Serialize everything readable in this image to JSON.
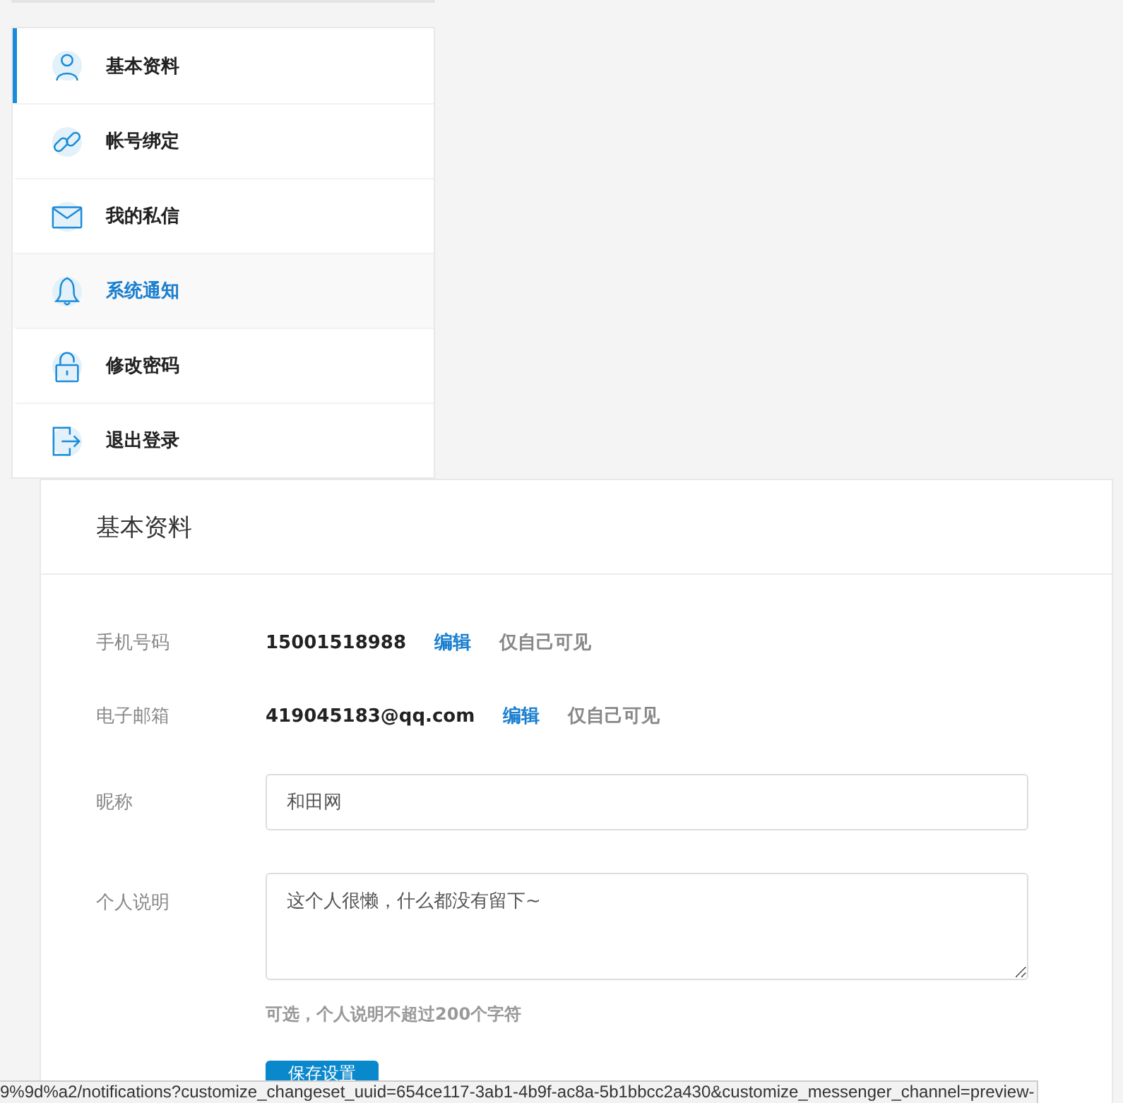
{
  "sidebar": {
    "items": [
      {
        "label": "基本资料",
        "kind": "user",
        "selected": true,
        "highlighted": false
      },
      {
        "label": "帐号绑定",
        "kind": "link",
        "selected": false,
        "highlighted": false
      },
      {
        "label": "我的私信",
        "kind": "mail",
        "selected": false,
        "highlighted": false
      },
      {
        "label": "系统通知",
        "kind": "bell",
        "selected": false,
        "highlighted": true
      },
      {
        "label": "修改密码",
        "kind": "lock",
        "selected": false,
        "highlighted": false
      },
      {
        "label": "退出登录",
        "kind": "logout",
        "selected": false,
        "highlighted": false
      }
    ]
  },
  "profile": {
    "title": "基本资料",
    "info_rows": [
      {
        "label": "手机号码",
        "value": "15001518988",
        "action": "编辑",
        "visibility": "仅自己可见"
      },
      {
        "label": "电子邮箱",
        "value": "419045183@qq.com",
        "action": "编辑",
        "visibility": "仅自己可见"
      }
    ],
    "nickname": {
      "label": "昵称",
      "value": "和田网"
    },
    "bio": {
      "label": "个人说明",
      "value": "这个人很懒，什么都没有留下~",
      "hint": "可选，个人说明不超过200个字符"
    },
    "save_button": "保存设置"
  },
  "status_bar": "9%9d%a2/notifications?customize_changeset_uuid=654ce117-3ab1-4b9f-ac8a-5b1bbcc2a430&customize_messenger_channel=preview-"
}
